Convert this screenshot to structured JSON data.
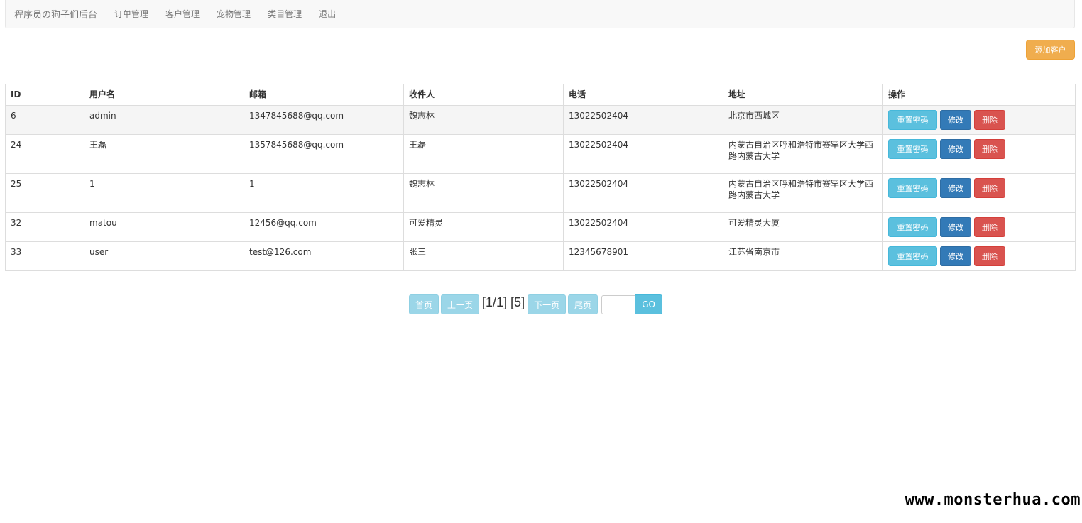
{
  "navbar": {
    "brand": "程序员の狗子们后台",
    "links": [
      "订单管理",
      "客户管理",
      "宠物管理",
      "类目管理",
      "退出"
    ]
  },
  "toolbar": {
    "add_label": "添加客户"
  },
  "table": {
    "headers": [
      "ID",
      "用户名",
      "邮箱",
      "收件人",
      "电话",
      "地址",
      "操作"
    ],
    "rows": [
      [
        "6",
        "admin",
        "1347845688@qq.com",
        "魏志林",
        "13022502404",
        "北京市西城区"
      ],
      [
        "24",
        "王磊",
        "1357845688@qq.com",
        "王磊",
        "13022502404",
        "内蒙古自治区呼和浩特市赛罕区大学西路内蒙古大学"
      ],
      [
        "25",
        "1",
        "1",
        "魏志林",
        "13022502404",
        "内蒙古自治区呼和浩特市赛罕区大学西路内蒙古大学"
      ],
      [
        "32",
        "matou",
        "12456@qq.com",
        "可爱精灵",
        "13022502404",
        "可爱精灵大厦"
      ],
      [
        "33",
        "user",
        "test@126.com",
        "张三",
        "12345678901",
        "江苏省南京市"
      ]
    ],
    "actions": [
      "重置密码",
      "修改",
      "删除"
    ]
  },
  "pagination": {
    "first": "首页",
    "prev": "上一页",
    "info": "[1/1] [5]",
    "next": "下一页",
    "last": "尾页",
    "go": "GO",
    "input_value": ""
  },
  "watermark": "www.monsterhua.com",
  "colors": {
    "warning": "#f0ad4e",
    "info": "#5bc0de",
    "primary": "#337ab7",
    "danger": "#d9534f"
  }
}
